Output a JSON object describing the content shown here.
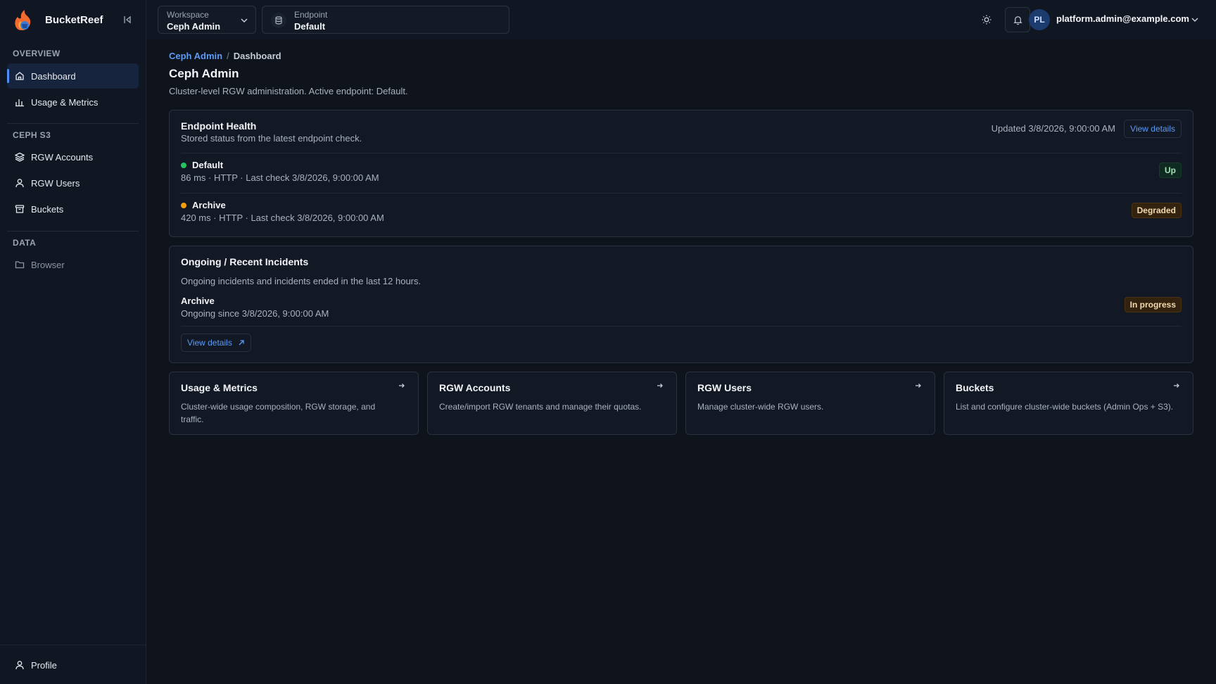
{
  "app": {
    "name": "BucketReef"
  },
  "sidebar": {
    "sections": [
      {
        "label": "OVERVIEW",
        "items": [
          {
            "label": "Dashboard"
          },
          {
            "label": "Usage & Metrics"
          }
        ]
      },
      {
        "label": "CEPH S3",
        "items": [
          {
            "label": "RGW Accounts"
          },
          {
            "label": "RGW Users"
          },
          {
            "label": "Buckets"
          }
        ]
      },
      {
        "label": "DATA",
        "items": [
          {
            "label": "Browser"
          }
        ]
      }
    ],
    "profile_label": "Profile"
  },
  "topbar": {
    "workspace": {
      "label": "Workspace",
      "value": "Ceph Admin"
    },
    "endpoint": {
      "label": "Endpoint",
      "value": "Default"
    },
    "user": {
      "initials": "PL",
      "email": "platform.admin@example.com"
    }
  },
  "breadcrumb": {
    "link": "Ceph Admin",
    "separator": "/",
    "current": "Dashboard"
  },
  "page": {
    "title": "Ceph Admin",
    "subtitle": "Cluster-level RGW administration. Active endpoint: Default."
  },
  "health": {
    "title": "Endpoint Health",
    "subtitle": "Stored status from the latest endpoint check.",
    "updated": "Updated 3/8/2026, 9:00:00 AM",
    "view_details": "View details",
    "rows": [
      {
        "name": "Default",
        "meta": "86 ms · HTTP · Last check 3/8/2026, 9:00:00 AM",
        "status": "Up",
        "dot_color": "#22c55e"
      },
      {
        "name": "Archive",
        "meta": "420 ms · HTTP · Last check 3/8/2026, 9:00:00 AM",
        "status": "Degraded",
        "dot_color": "#f59e0b"
      }
    ]
  },
  "incidents": {
    "title": "Ongoing / Recent Incidents",
    "subtitle": "Ongoing incidents and incidents ended in the last 12 hours.",
    "rows": [
      {
        "name": "Archive",
        "meta": "Ongoing since 3/8/2026, 9:00:00 AM",
        "status": "In progress"
      }
    ],
    "view_details": "View details"
  },
  "tiles": [
    {
      "title": "Usage & Metrics",
      "desc": "Cluster-wide usage composition, RGW storage, and traffic."
    },
    {
      "title": "RGW Accounts",
      "desc": "Create/import RGW tenants and manage their quotas."
    },
    {
      "title": "RGW Users",
      "desc": "Manage cluster-wide RGW users."
    },
    {
      "title": "Buckets",
      "desc": "List and configure cluster-wide buckets (Admin Ops + S3)."
    }
  ],
  "colors": {
    "accent": "#4f8ff7",
    "link": "#5d9bf5",
    "up": "#22c55e",
    "degraded": "#f59e0b"
  }
}
